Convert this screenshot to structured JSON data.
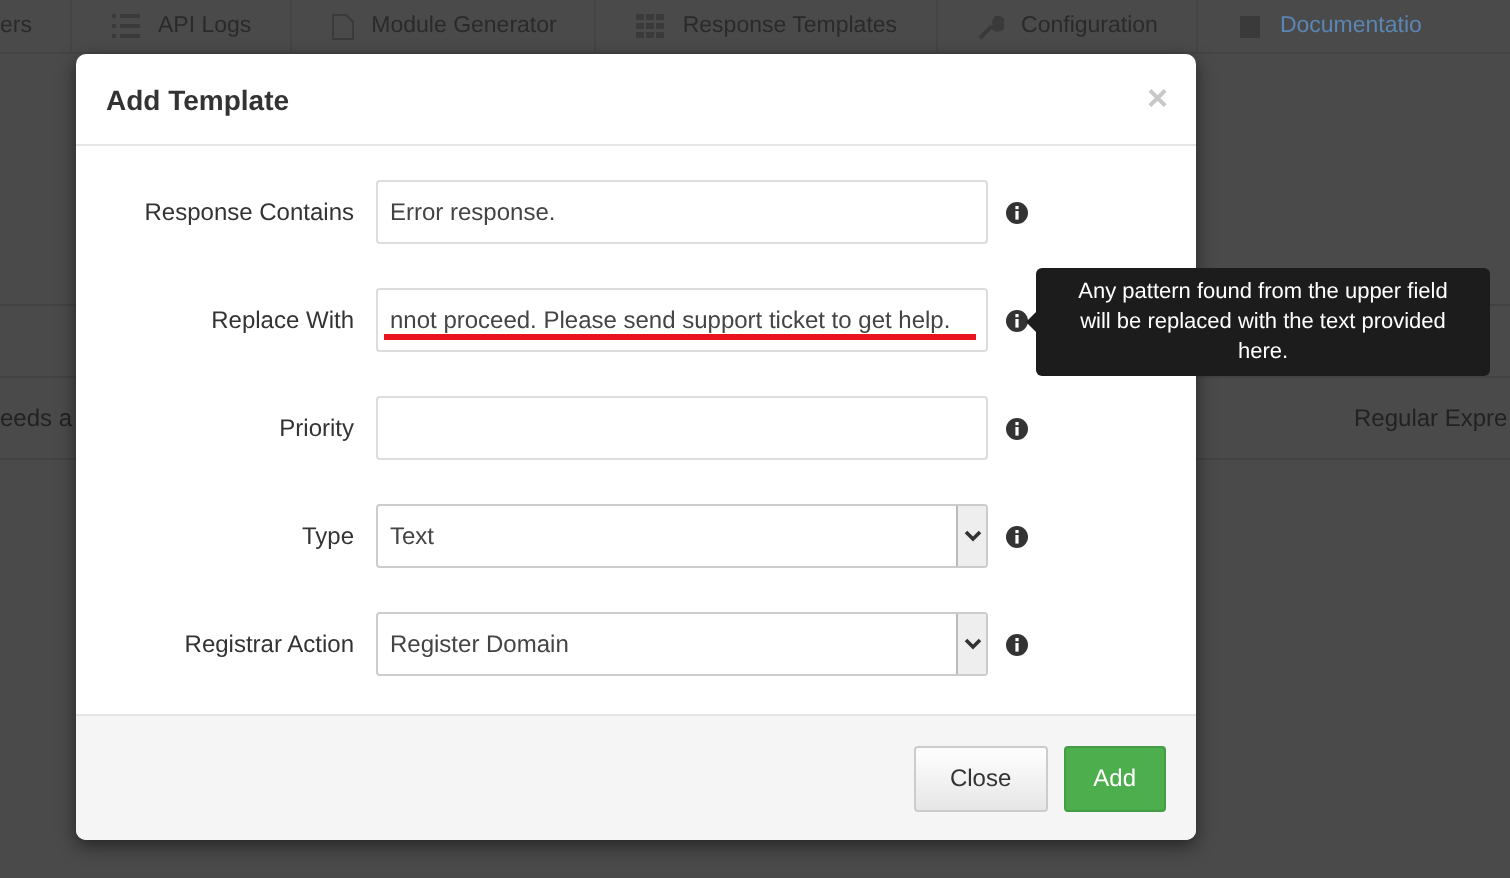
{
  "background": {
    "nav_items": [
      {
        "label": "ers",
        "selected": false
      },
      {
        "label": "API Logs",
        "selected": false
      },
      {
        "label": "Module Generator",
        "selected": false
      },
      {
        "label": "Response Templates",
        "selected": false
      },
      {
        "label": "Configuration",
        "selected": false
      },
      {
        "label": "Documentatio",
        "selected": true
      }
    ],
    "table_cells": [
      "eeds a",
      "Regular Expre"
    ]
  },
  "dialog": {
    "title": "Add Template",
    "close": "×",
    "fields": [
      {
        "label": "Response Contains",
        "kind": "text",
        "value": "Error response.",
        "underlined": false
      },
      {
        "label": "Replace With",
        "kind": "text",
        "value": "nnot proceed. Please send support ticket to get help.",
        "underlined": true,
        "tooltip": "Any pattern found from the upper field will be replaced with the text provided here."
      },
      {
        "label": "Priority",
        "kind": "text",
        "underlined": false
      },
      {
        "label": "Type",
        "kind": "select",
        "value": "Text",
        "underlined": false
      },
      {
        "label": "Registrar Action",
        "kind": "select",
        "value": "Register Domain",
        "underlined": false
      }
    ],
    "buttons": [
      {
        "label": "Close",
        "kind": "default"
      },
      {
        "label": "Add",
        "kind": "primary"
      }
    ]
  }
}
